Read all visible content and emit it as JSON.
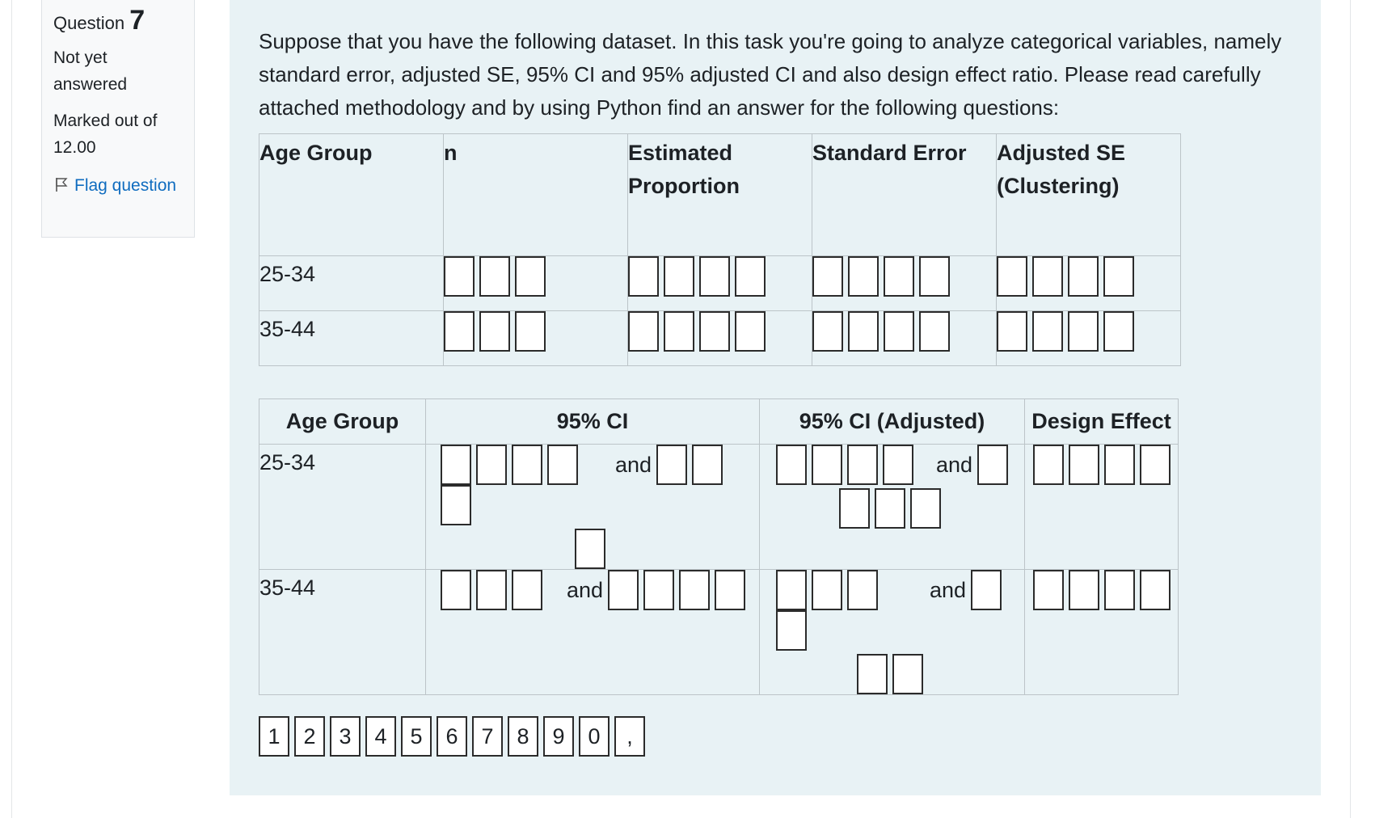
{
  "info": {
    "question_word": "Question",
    "question_number": "7",
    "state": "Not yet answered",
    "grade": "Marked out of 12.00",
    "flag_label": "Flag question"
  },
  "question": {
    "text": "Suppose that you have the following dataset. In this task you're going to analyze categorical variables, namely standard error, adjusted SE, 95% CI and 95% adjusted CI and also design effect ratio. Please read carefully attached methodology and by using Python find an answer for the following questions:"
  },
  "table1": {
    "headers": [
      "Age Group",
      "n",
      "Estimated Proportion",
      "Standard Error",
      "Adjusted SE (Clustering)"
    ],
    "rows": [
      {
        "label": "25-34"
      },
      {
        "label": "35-44"
      }
    ]
  },
  "table2": {
    "headers": [
      "Age Group",
      "95% CI",
      "95% CI (Adjusted)",
      "Design Effect"
    ],
    "and_word": "and",
    "rows": [
      {
        "label": "25-34"
      },
      {
        "label": "35-44"
      }
    ]
  },
  "tokens": [
    "1",
    "2",
    "3",
    "4",
    "5",
    "6",
    "7",
    "8",
    "9",
    "0",
    ","
  ],
  "colors": {
    "question_bg": "#e8f2f5",
    "info_bg": "#f8f9fa",
    "link": "#0f6cbf"
  }
}
